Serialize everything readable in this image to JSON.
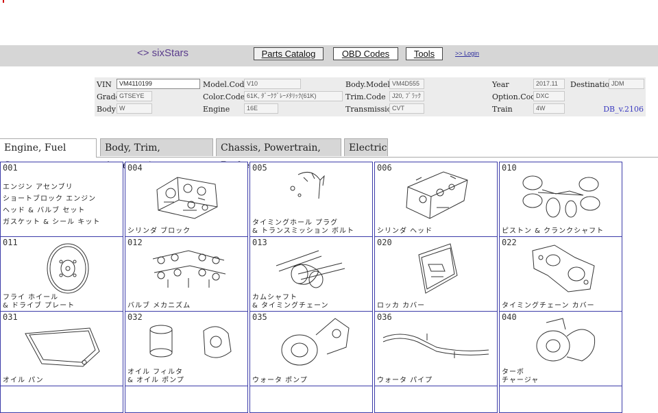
{
  "header": {
    "logo": "<> sixStars",
    "nav": [
      "Parts Catalog",
      "OBD Codes",
      "Tools"
    ],
    "login": ">> Login"
  },
  "vehicle": {
    "vin_label": "VIN",
    "vin": "VM4110199",
    "model_code_label": "Model.Code",
    "model_code": "V10",
    "body_model_label": "Body.Model",
    "body_model": "VM4D555",
    "year_label": "Year",
    "year": "2017.11",
    "destination_label": "Destination",
    "destination": "JDM",
    "grade_label": "Grade",
    "grade": "GTSEYE",
    "color_code_label": "Color.Code",
    "color_code": "61K, ﾀﾞｰｸｸﾞﾚｰﾒﾀﾘｯｸ(61K)",
    "trim_code_label": "Trim.Code",
    "trim_code": "J20, ﾌﾞﾗｯｸ",
    "option_code_label": "Option.Code",
    "option_code": "DXC",
    "body_label": "Body",
    "body": "W",
    "engine_label": "Engine",
    "engine": "16E",
    "transmission_label": "Transmission",
    "transmission": "CVT",
    "train_label": "Train",
    "train": "4W",
    "db_version": "DB_v.2106"
  },
  "tabs": [
    "Engine, Fuel Systems",
    "Body, Trim, Accessories",
    "Chassis, Powertrain, Brake",
    "Electric"
  ],
  "parts": [
    {
      "code": "001",
      "name": "エンジン アセンブリ\nショートブロック エンジン\nヘッド & バルブ セット\nガスケット & シール キット"
    },
    {
      "code": "004",
      "name": "シリンダ ブロック"
    },
    {
      "code": "005",
      "name": "タイミングホール プラグ\n& トランスミッション ボルト"
    },
    {
      "code": "006",
      "name": "シリンダ ヘッド"
    },
    {
      "code": "010",
      "name": "ピストン & クランクシャフト"
    },
    {
      "code": "011",
      "name": "フライ ホイール\n& ドライブ プレート"
    },
    {
      "code": "012",
      "name": "バルブ メカニズム"
    },
    {
      "code": "013",
      "name": "カムシャフト\n& タイミングチェーン"
    },
    {
      "code": "020",
      "name": "ロッカ カバー"
    },
    {
      "code": "022",
      "name": "タイミングチェーン カバー"
    },
    {
      "code": "031",
      "name": "オイル パン"
    },
    {
      "code": "032",
      "name": "オイル フィルタ\n& オイル ポンプ"
    },
    {
      "code": "035",
      "name": "ウォータ ポンプ"
    },
    {
      "code": "036",
      "name": "ウォータ パイプ"
    },
    {
      "code": "040",
      "name": "ターボ\nチャージャ"
    }
  ]
}
